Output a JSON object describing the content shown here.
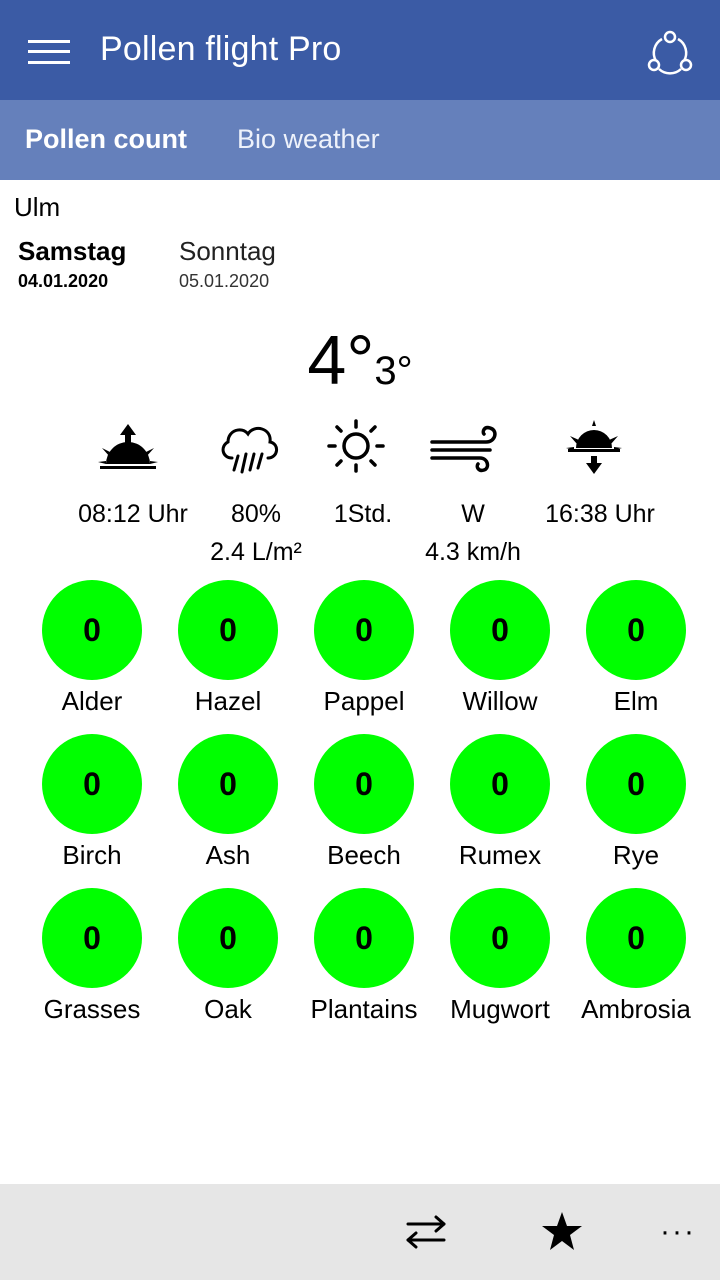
{
  "app": {
    "title": "Pollen flight Pro"
  },
  "tabs": [
    {
      "label": "Pollen count",
      "active": true
    },
    {
      "label": "Bio weather",
      "active": false
    }
  ],
  "location": "Ulm",
  "days": [
    {
      "name": "Samstag",
      "date": "04.01.2020",
      "selected": true
    },
    {
      "name": "Sonntag",
      "date": "05.01.2020",
      "selected": false
    }
  ],
  "temperature": {
    "max": "4°",
    "min": "3°"
  },
  "weather": {
    "sunrise": {
      "icon": "sunrise-icon",
      "value": "08:12 Uhr"
    },
    "rain": {
      "icon": "rain-cloud-icon",
      "value": "80%",
      "amount": "2.4 L/m²"
    },
    "sunshine": {
      "icon": "sun-icon",
      "value": "1Std."
    },
    "wind": {
      "icon": "wind-icon",
      "value": "W",
      "speed": "4.3 km/h"
    },
    "sunset": {
      "icon": "sunset-icon",
      "value": "16:38 Uhr"
    }
  },
  "pollen": [
    {
      "name": "Alder",
      "value": "0"
    },
    {
      "name": "Hazel",
      "value": "0"
    },
    {
      "name": "Pappel",
      "value": "0"
    },
    {
      "name": "Willow",
      "value": "0"
    },
    {
      "name": "Elm",
      "value": "0"
    },
    {
      "name": "Birch",
      "value": "0"
    },
    {
      "name": "Ash",
      "value": "0"
    },
    {
      "name": "Beech",
      "value": "0"
    },
    {
      "name": "Rumex",
      "value": "0"
    },
    {
      "name": "Rye",
      "value": "0"
    },
    {
      "name": "Grasses",
      "value": "0"
    },
    {
      "name": "Oak",
      "value": "0"
    },
    {
      "name": "Plantains",
      "value": "0"
    },
    {
      "name": "Mugwort",
      "value": "0"
    },
    {
      "name": "Ambrosia",
      "value": "0"
    }
  ],
  "appbar": {
    "buttons": [
      {
        "icon": "swap-arrows-icon"
      },
      {
        "icon": "star-icon"
      },
      {
        "icon": "more-icon",
        "label": "···"
      }
    ]
  },
  "colors": {
    "titlebar": "#3b5ba5",
    "tabbar": "#6580bb",
    "pollen_none": "#00ff00",
    "appbar": "#e6e6e6"
  }
}
